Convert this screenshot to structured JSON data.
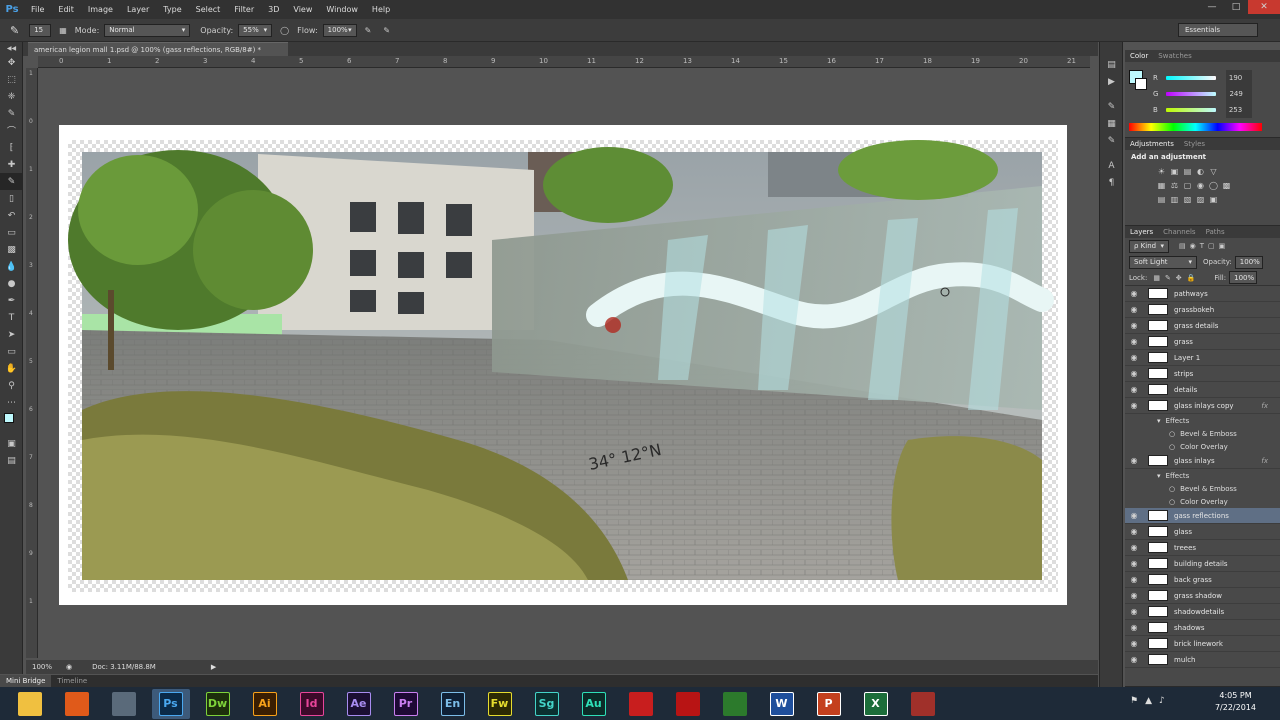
{
  "app": {
    "logo": "Ps"
  },
  "menu": [
    "File",
    "Edit",
    "Image",
    "Layer",
    "Type",
    "Select",
    "Filter",
    "3D",
    "View",
    "Window",
    "Help"
  ],
  "options": {
    "brush_size": "15",
    "mode_label": "Mode:",
    "mode_value": "Normal",
    "opacity_label": "Opacity:",
    "opacity_value": "55%",
    "flow_label": "Flow:",
    "flow_value": "100%"
  },
  "workspace": "Essentials",
  "document": {
    "tab_title": "american legion mall 1.psd @ 100% (gass reflections, RGB/8#) *"
  },
  "ruler": {
    "h_ticks": [
      "0",
      "1",
      "2",
      "3",
      "4",
      "5",
      "6",
      "7",
      "8",
      "9",
      "10",
      "11",
      "12",
      "13",
      "14",
      "15",
      "16",
      "17",
      "18",
      "19",
      "20",
      "21"
    ],
    "v_ticks": [
      "1",
      "0",
      "1",
      "2",
      "3",
      "4",
      "5",
      "6",
      "7",
      "8",
      "9",
      "1"
    ]
  },
  "canvas_text": {
    "engraving": "34° 12°N"
  },
  "status": {
    "zoom": "100%",
    "doc": "Doc: 3.11M/88.8M"
  },
  "bottom_tabs": [
    "Mini Bridge",
    "Timeline"
  ],
  "color_panel": {
    "tabs": [
      "Color",
      "Swatches"
    ],
    "r_label": "R",
    "g_label": "G",
    "b_label": "B",
    "r": "190",
    "g": "249",
    "b": "253",
    "fg_color": "#bef9fd"
  },
  "adjustments_panel": {
    "tabs": [
      "Adjustments",
      "Styles"
    ],
    "title": "Add an adjustment"
  },
  "layers_panel": {
    "tabs": [
      "Layers",
      "Channels",
      "Paths"
    ],
    "filter": "ρ Kind",
    "blend_mode": "Soft Light",
    "opacity_label": "Opacity:",
    "opacity": "100%",
    "lock_label": "Lock:",
    "fill_label": "Fill:",
    "fill": "100%",
    "layers": [
      {
        "name": "pathways"
      },
      {
        "name": "grassbokeh"
      },
      {
        "name": "grass details"
      },
      {
        "name": "grass"
      },
      {
        "name": "Layer 1"
      },
      {
        "name": "strips"
      },
      {
        "name": "details"
      },
      {
        "name": "glass inlays copy",
        "fx": true
      },
      {
        "name": "Effects",
        "effect": true
      },
      {
        "name": "Bevel & Emboss",
        "effect": true,
        "sub": true
      },
      {
        "name": "Color Overlay",
        "effect": true,
        "sub": true
      },
      {
        "name": "glass inlays",
        "fx": true
      },
      {
        "name": "Effects",
        "effect": true
      },
      {
        "name": "Bevel & Emboss",
        "effect": true,
        "sub": true
      },
      {
        "name": "Color Overlay",
        "effect": true,
        "sub": true
      },
      {
        "name": "gass reflections",
        "selected": true
      },
      {
        "name": "glass"
      },
      {
        "name": "treees"
      },
      {
        "name": "building details"
      },
      {
        "name": "back grass"
      },
      {
        "name": "grass shadow"
      },
      {
        "name": "shadowdetails"
      },
      {
        "name": "shadows"
      },
      {
        "name": "brick linework"
      },
      {
        "name": "mulch"
      }
    ],
    "fx_symbol": "fx"
  },
  "taskbar": {
    "apps": [
      {
        "label": "",
        "color": "#f0c040",
        "name": "explorer"
      },
      {
        "label": "",
        "color": "#e05a1a",
        "name": "firefox"
      },
      {
        "label": "",
        "color": "#5a6a7a",
        "name": "app3"
      },
      {
        "label": "Ps",
        "color": "#0b2a48",
        "fg": "#4aa8f0",
        "name": "photoshop"
      },
      {
        "label": "Dw",
        "color": "#1d2f0c",
        "fg": "#7ed33a",
        "name": "dreamweaver"
      },
      {
        "label": "Ai",
        "color": "#3a1e02",
        "fg": "#f7a11a",
        "name": "illustrator"
      },
      {
        "label": "Id",
        "color": "#3c0a2a",
        "fg": "#e8459a",
        "name": "indesign"
      },
      {
        "label": "Ae",
        "color": "#1b0f33",
        "fg": "#a88cf0",
        "name": "after-effects"
      },
      {
        "label": "Pr",
        "color": "#1e0a35",
        "fg": "#c97ff0",
        "name": "premiere"
      },
      {
        "label": "En",
        "color": "#0f2035",
        "fg": "#7cbde8",
        "name": "encore"
      },
      {
        "label": "Fw",
        "color": "#2d2a04",
        "fg": "#e6dc2e",
        "name": "fireworks"
      },
      {
        "label": "Sg",
        "color": "#0b3030",
        "fg": "#44d4c8",
        "name": "speedgrade"
      },
      {
        "label": "Au",
        "color": "#0c2b28",
        "fg": "#2ee0b8",
        "name": "audition"
      },
      {
        "label": "",
        "color": "#c81e1e",
        "name": "acrobat-reader"
      },
      {
        "label": "",
        "color": "#b81414",
        "name": "acrobat"
      },
      {
        "label": "",
        "color": "#2c7a2c",
        "name": "chrome"
      },
      {
        "label": "W",
        "color": "#1f4f9c",
        "fg": "#ffffff",
        "name": "word"
      },
      {
        "label": "P",
        "color": "#c4401e",
        "fg": "#ffffff",
        "name": "powerpoint"
      },
      {
        "label": "X",
        "color": "#1c6e3a",
        "fg": "#ffffff",
        "name": "excel"
      },
      {
        "label": "",
        "color": "#a0302a",
        "name": "paint"
      }
    ],
    "time": "4:05 PM",
    "date": "7/22/2014"
  }
}
